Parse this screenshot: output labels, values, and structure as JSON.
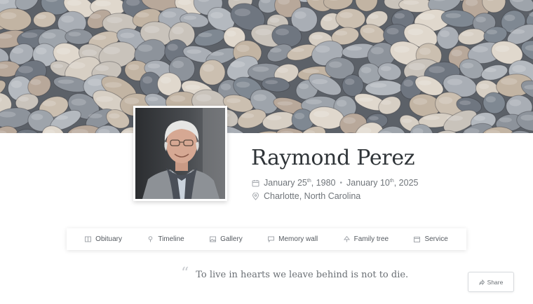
{
  "profile": {
    "name": "Raymond Perez",
    "birth": {
      "month": "January",
      "day": "25",
      "suffix": "th",
      "year": ", 1980"
    },
    "death": {
      "month": "January",
      "day": "10",
      "suffix": "th",
      "year": ", 2025"
    },
    "separator": "•",
    "location": "Charlotte, North Carolina"
  },
  "nav": {
    "tabs": [
      {
        "label": "Obituary",
        "icon": "book-icon"
      },
      {
        "label": "Timeline",
        "icon": "pin-icon"
      },
      {
        "label": "Gallery",
        "icon": "image-icon"
      },
      {
        "label": "Memory wall",
        "icon": "chat-icon"
      },
      {
        "label": "Family tree",
        "icon": "tree-icon"
      },
      {
        "label": "Service",
        "icon": "calendar-icon"
      }
    ]
  },
  "quote": {
    "mark": "“",
    "text": "To live in hearts we leave behind is not to die."
  },
  "share": {
    "label": "Share",
    "icon": "share-icon"
  },
  "colors": {
    "text_dark": "#2f3438",
    "text_muted": "#70757a",
    "cover_stone": "#8d8f93"
  }
}
